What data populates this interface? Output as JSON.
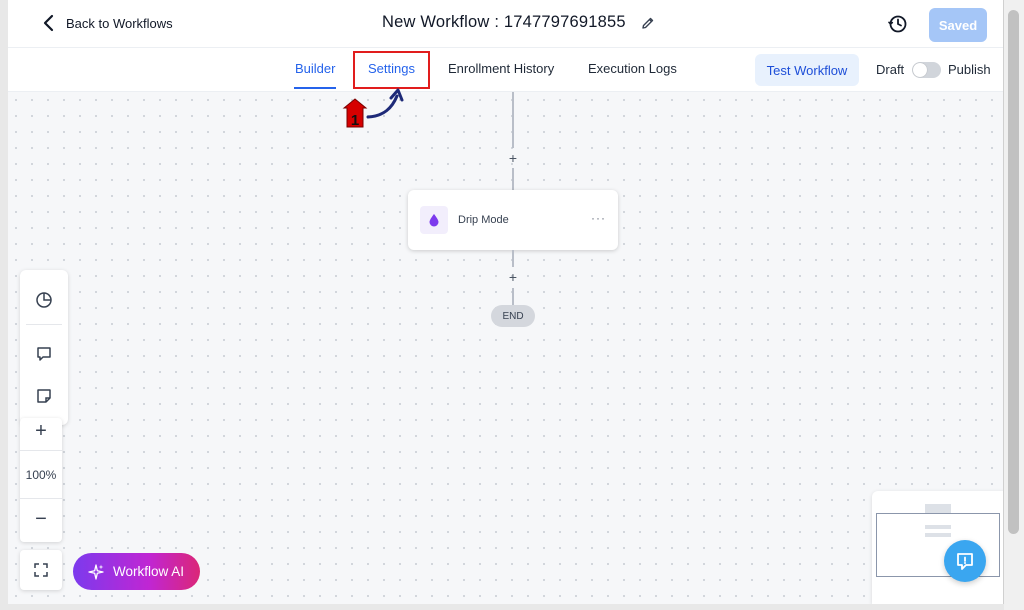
{
  "header": {
    "back_label": "Back to Workflows",
    "title": "New Workflow : 1747797691855",
    "saved_label": "Saved"
  },
  "tabs": [
    {
      "label": "Builder",
      "active": true
    },
    {
      "label": "Settings",
      "active": false
    },
    {
      "label": "Enrollment History",
      "active": false
    },
    {
      "label": "Execution Logs",
      "active": false
    }
  ],
  "actions": {
    "test_label": "Test Workflow",
    "draft_label": "Draft",
    "publish_label": "Publish",
    "published": false
  },
  "annotation": {
    "step_number": "1"
  },
  "canvas": {
    "node_label": "Drip Mode",
    "node_icon": "droplet-icon",
    "end_label": "END"
  },
  "zoom": {
    "plus": "+",
    "level": "100%",
    "minus": "−"
  },
  "ai": {
    "label": "Workflow AI"
  },
  "colors": {
    "accent": "#2563eb",
    "highlight": "#e11d1d",
    "saved_bg": "#a5c6f7",
    "node_icon": "#7c3aed"
  }
}
